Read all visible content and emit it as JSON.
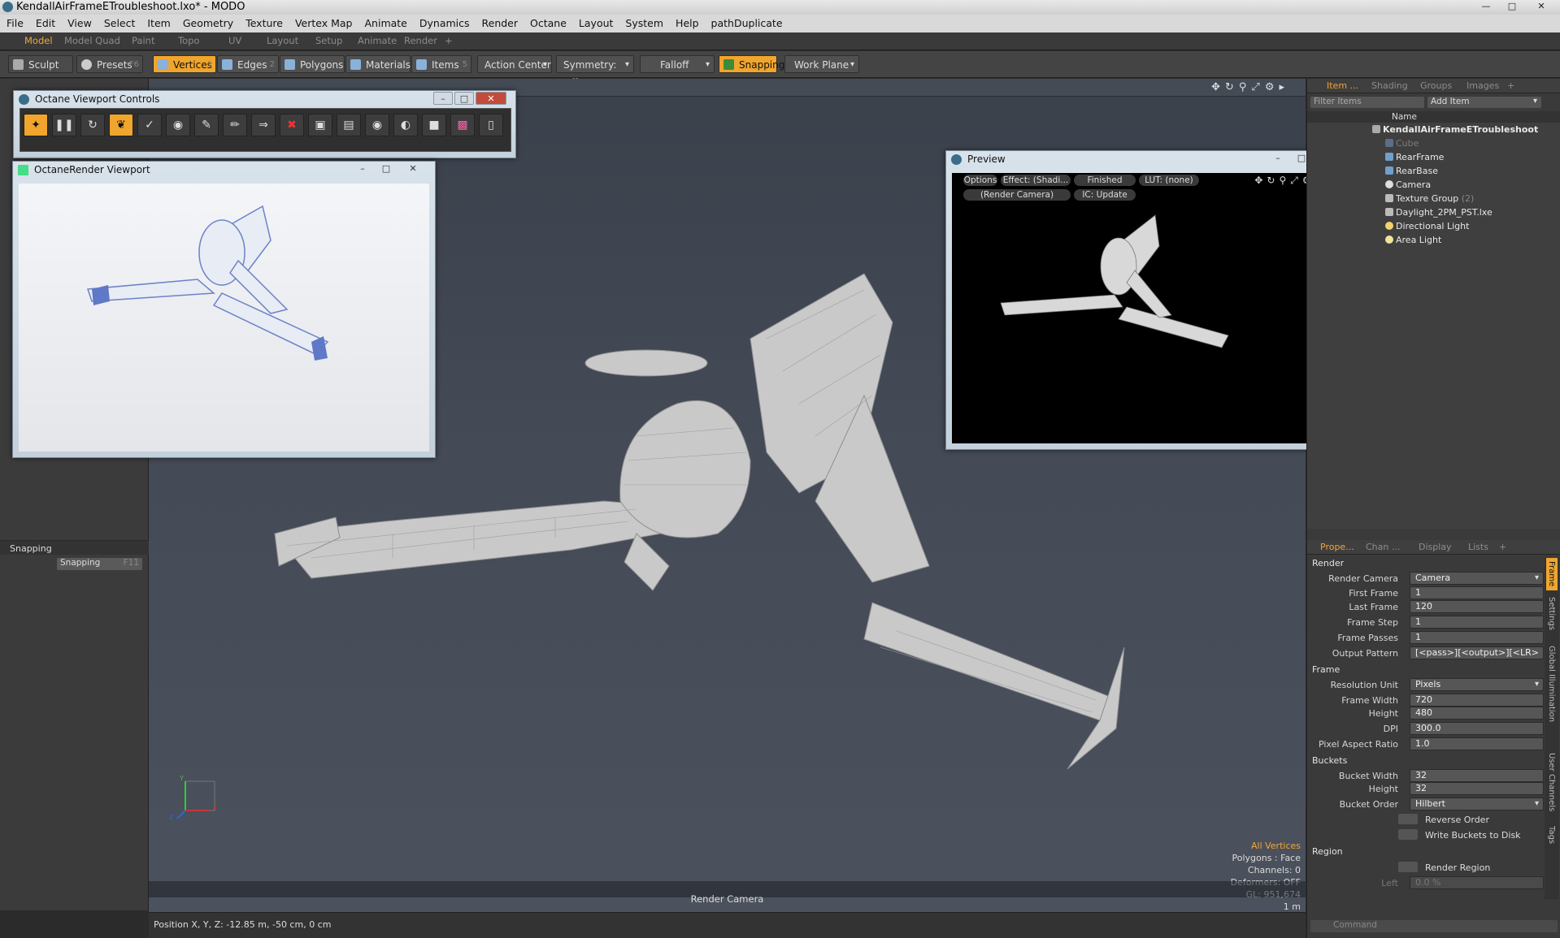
{
  "window": {
    "title": "KendallAirFrameETroubleshoot.lxo* - MODO"
  },
  "menu": [
    "File",
    "Edit",
    "View",
    "Select",
    "Item",
    "Geometry",
    "Texture",
    "Vertex Map",
    "Animate",
    "Dynamics",
    "Render",
    "Octane",
    "Layout",
    "System",
    "Help",
    "pathDuplicate"
  ],
  "layout_tabs": [
    "Model",
    "Model Quad",
    "Paint",
    "Topo",
    "UV",
    "Layout",
    "Setup",
    "Animate",
    "Render",
    "+"
  ],
  "active_layout_tab": "Model",
  "toolbar": {
    "sculpt": "Sculpt",
    "presets": "Presets",
    "presets_key": "F6",
    "vertices": "Vertices",
    "vertices_key": "1",
    "edges": "Edges",
    "edges_key": "2",
    "polygons": "Polygons",
    "materials": "Materials",
    "items": "Items",
    "items_key": "5",
    "action_center": "Action Center",
    "symmetry": "Symmetry: Off",
    "falloff": "Falloff",
    "snapping": "Snapping",
    "work_plane": "Work Plane"
  },
  "left_panel": {
    "section": "Snapping",
    "button": "Snapping",
    "button_key": "F11"
  },
  "octane_controls": {
    "title": "Octane Viewport Controls"
  },
  "octane_viewport": {
    "title": "OctaneRender Viewport"
  },
  "preview": {
    "title": "Preview",
    "options": "Options",
    "effect": "Effect: (Shadi...",
    "status": "Finished",
    "lut": "LUT: (none)",
    "camera": "(Render Camera)",
    "ic": "IC: Update"
  },
  "viewport": {
    "camera_label": "Render Camera",
    "info": {
      "all_vertices": "All Vertices",
      "polygons": "Polygons : Face",
      "channels": "Channels: 0",
      "deformers": "Deformers: OFF",
      "gl": "GL: 951,674",
      "scale": "1 m"
    },
    "axis_x": "X",
    "axis_y": "Y",
    "axis_z": "Z"
  },
  "status_bar": {
    "position": "Position X, Y, Z:  -12.85 m, -50 cm, 0 cm"
  },
  "items_panel": {
    "tabs": [
      "Item ...",
      "Shading",
      "Groups",
      "Images",
      "+"
    ],
    "filter_placeholder": "Filter Items",
    "add_item": "Add Item",
    "name_header": "Name",
    "tree": [
      {
        "name": "KendallAirFrameETroubleshoot",
        "bold": true
      },
      {
        "name": "Cube",
        "dim": true
      },
      {
        "name": "RearFrame"
      },
      {
        "name": "RearBase"
      },
      {
        "name": "Camera"
      },
      {
        "name": "Texture Group",
        "suffix": "(2)"
      },
      {
        "name": "Daylight_2PM_PST.lxe"
      },
      {
        "name": "Directional Light"
      },
      {
        "name": "Area Light"
      }
    ]
  },
  "properties_panel": {
    "tabs": [
      "Prope...",
      "Chan ...",
      "Display",
      "Lists",
      "+"
    ],
    "side_tabs": [
      "Frame",
      "Settings",
      "Global Illumination",
      "User Channels",
      "Tags"
    ],
    "sections": {
      "render": "Render",
      "frame": "Frame",
      "buckets": "Buckets",
      "region": "Region"
    },
    "fields": {
      "render_camera": {
        "label": "Render Camera",
        "value": "Camera"
      },
      "first_frame": {
        "label": "First Frame",
        "value": "1"
      },
      "last_frame": {
        "label": "Last Frame",
        "value": "120"
      },
      "frame_step": {
        "label": "Frame Step",
        "value": "1"
      },
      "frame_passes": {
        "label": "Frame Passes",
        "value": "1"
      },
      "output_pattern": {
        "label": "Output Pattern",
        "value": "[<pass>][<output>][<LR>"
      },
      "resolution_unit": {
        "label": "Resolution Unit",
        "value": "Pixels"
      },
      "frame_width": {
        "label": "Frame Width",
        "value": "720"
      },
      "frame_height": {
        "label": "Height",
        "value": "480"
      },
      "dpi": {
        "label": "DPI",
        "value": "300.0"
      },
      "pixel_aspect": {
        "label": "Pixel Aspect Ratio",
        "value": "1.0"
      },
      "bucket_width": {
        "label": "Bucket Width",
        "value": "32"
      },
      "bucket_height": {
        "label": "Height",
        "value": "32"
      },
      "bucket_order": {
        "label": "Bucket Order",
        "value": "Hilbert"
      },
      "reverse_order": {
        "label": "Reverse Order"
      },
      "write_buckets": {
        "label": "Write Buckets to Disk"
      },
      "render_region": {
        "label": "Render Region"
      },
      "left": {
        "label": "Left",
        "value": "0.0 %"
      }
    },
    "command_placeholder": "Command"
  }
}
